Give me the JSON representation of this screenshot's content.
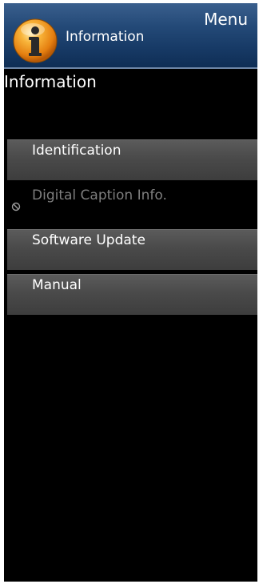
{
  "header": {
    "menu_label": "Menu",
    "section_label": "Information",
    "icon": "info-icon"
  },
  "page": {
    "title": "Information"
  },
  "menu": {
    "items": [
      {
        "label": "Identification",
        "enabled": true
      },
      {
        "label": "Digital Caption Info.",
        "enabled": false,
        "status_icon": "disabled-icon"
      },
      {
        "label": "Software Update",
        "enabled": true
      },
      {
        "label": "Manual",
        "enabled": true
      }
    ]
  },
  "colors": {
    "header_blue": "#173a66",
    "item_gray": "#4a4a4a",
    "disabled_text": "#7e7e7e",
    "icon_orange": "#f39a1f"
  }
}
